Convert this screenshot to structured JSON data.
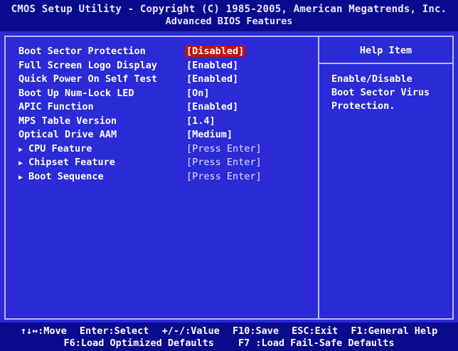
{
  "header": {
    "title": "CMOS Setup Utility - Copyright (C) 1985-2005, American Megatrends, Inc.",
    "subtitle": "Advanced BIOS Features"
  },
  "menu": {
    "items": [
      {
        "label": "Boot Sector Protection",
        "value": "[Disabled]"
      },
      {
        "label": "Full Screen Logo Display",
        "value": "[Enabled]"
      },
      {
        "label": "Quick Power On Self Test",
        "value": "[Enabled]"
      },
      {
        "label": "Boot Up Num-Lock LED",
        "value": "[On]"
      },
      {
        "label": "APIC Function",
        "value": "[Enabled]"
      },
      {
        "label": "MPS Table Version",
        "value": "[1.4]"
      },
      {
        "label": "Optical Drive AAM",
        "value": "[Medium]"
      },
      {
        "label": "CPU Feature",
        "value": "[Press Enter]"
      },
      {
        "label": "Chipset Feature",
        "value": "[Press Enter]"
      },
      {
        "label": "Boot Sequence",
        "value": "[Press Enter]"
      }
    ]
  },
  "help": {
    "title": "Help Item",
    "lines": [
      "Enable/Disable",
      "Boot Sector Virus",
      "Protection."
    ]
  },
  "footer": {
    "line1": [
      "↑↓↔:Move",
      "Enter:Select",
      "+/-/:Value",
      "F10:Save",
      "ESC:Exit",
      "F1:General Help"
    ],
    "line2": [
      "F6:Load Optimized Defaults",
      "F7 :Load Fail-Safe Defaults"
    ]
  },
  "colors": {
    "background": "#2a2ad6",
    "header_bg": "#0a0a8c",
    "highlight": "#c31010",
    "border": "#b8b8ff"
  },
  "icons": {
    "submenu_arrow": "triangle-right-icon"
  }
}
